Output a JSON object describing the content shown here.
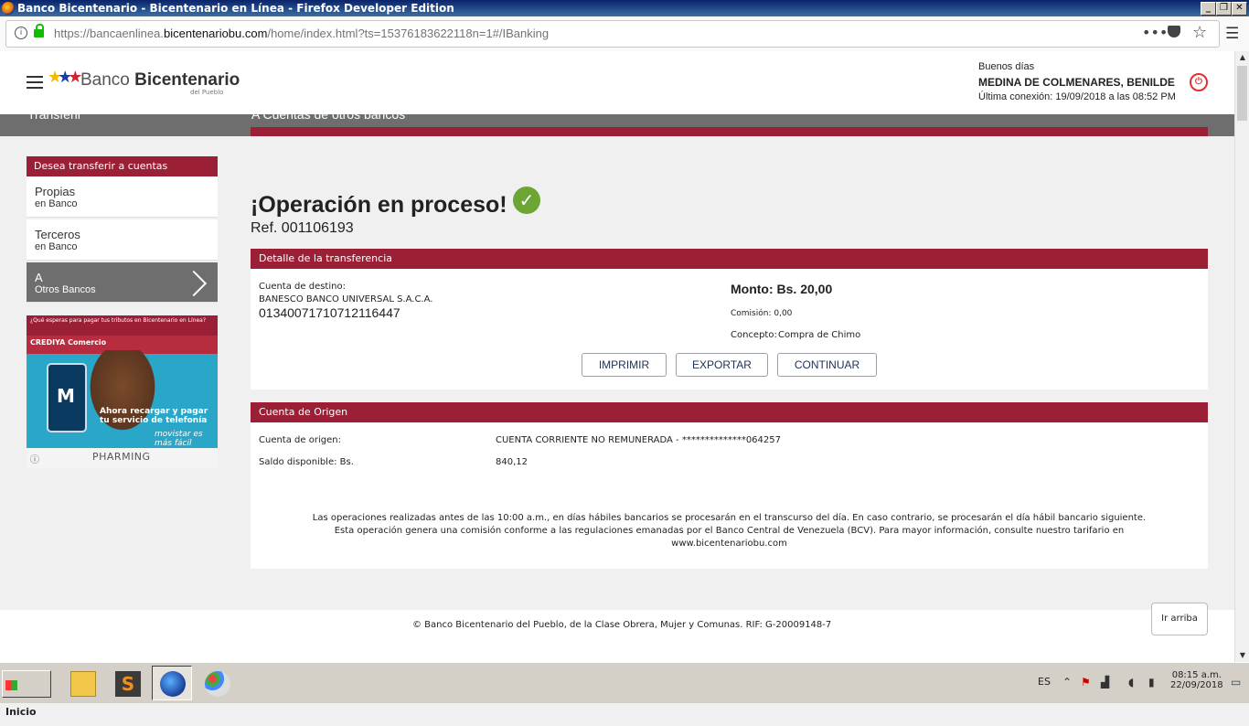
{
  "window": {
    "title": "Banco Bicentenario - Bicentenario en Línea - Firefox Developer Edition",
    "controls": [
      "_",
      "❐",
      "✕"
    ]
  },
  "browser": {
    "url_prefix": "https://bancaenlinea.",
    "url_domain": "bicentenariobu.com",
    "url_suffix": "/home/index.html?ts=15376183622118n=1#/IBanking",
    "page_actions_icon": "•••",
    "pocket_icon": "pocket-icon",
    "bookmark_icon": "☆",
    "menu_icon": "☰"
  },
  "header": {
    "logo_text_light": "Banco ",
    "logo_text_bold": "Bicentenario",
    "logo_sub": "del Pueblo",
    "greeting": "Buenos días",
    "user_name": "MEDINA DE COLMENARES, BENILDE",
    "last_connection": "Última conexión: 19/09/2018 a las 08:52 PM"
  },
  "section_bar": {
    "left": "Transferir",
    "right": "A Cuentas de otros bancos"
  },
  "sidebar": {
    "heading": "Desea transferir a cuentas",
    "items": [
      {
        "line1": "Propias",
        "line2": "en Banco",
        "active": false
      },
      {
        "line1": "Terceros",
        "line2": "en Banco",
        "active": false
      },
      {
        "line1": "A",
        "line2": "Otros Bancos",
        "active": true
      }
    ]
  },
  "ad": {
    "top_text": "¿Qué esperas para pagar tus tributos en Bicentenario en Línea?",
    "credi": "CREDIYA Comercio",
    "message": "Ahora recargar y pagar tu servicio de telefonía",
    "brand": "movistar es más fácil",
    "footer": "PHARMING"
  },
  "result": {
    "title": "¡Operación en proceso!",
    "reference": "Ref. 001106193"
  },
  "transfer_detail": {
    "heading": "Detalle de la transferencia",
    "dest_label": "Cuenta de destino:",
    "dest_bank": "BANESCO BANCO UNIVERSAL S.A.C.A.",
    "dest_account": "01340071710712116447",
    "amount": "Monto: Bs. 20,00",
    "commission": "Comisión: 0,00",
    "concept_label": "Concepto:",
    "concept_value": "Compra de Chimo",
    "buttons": {
      "print": "IMPRIMIR",
      "export": "EXPORTAR",
      "continue": "CONTINUAR"
    }
  },
  "origin": {
    "heading": "Cuenta de Origen",
    "account_label": "Cuenta de origen:",
    "account_value": "CUENTA CORRIENTE NO REMUNERADA - **************064257",
    "balance_label": "Saldo disponible: Bs.",
    "balance_value": "840,12",
    "notice_1": "Las operaciones realizadas antes de las 10:00 a.m., en días hábiles bancarios se procesarán en el transcurso del día. En caso contrario, se procesarán el día hábil bancario siguiente.",
    "notice_2": "Esta operación genera una comisión conforme a las regulaciones emanadas por el Banco Central de Venezuela (BCV). Para mayor información, consulte nuestro tarifario en",
    "notice_3": "www.bicentenariobu.com"
  },
  "footer": {
    "copyright": "© Banco Bicentenario del Pueblo, de la Clase Obrera, Mujer y Comunas. RIF: G-20009148-7",
    "back_to_top": "Ir arriba"
  },
  "taskbar": {
    "start_label": "Inicio",
    "language": "ES",
    "time": "08:15 a.m.",
    "date": "22/09/2018"
  },
  "colors": {
    "brand_red": "#9b1f35",
    "section_grey": "#6e6e6e",
    "success_green": "#6da534"
  }
}
